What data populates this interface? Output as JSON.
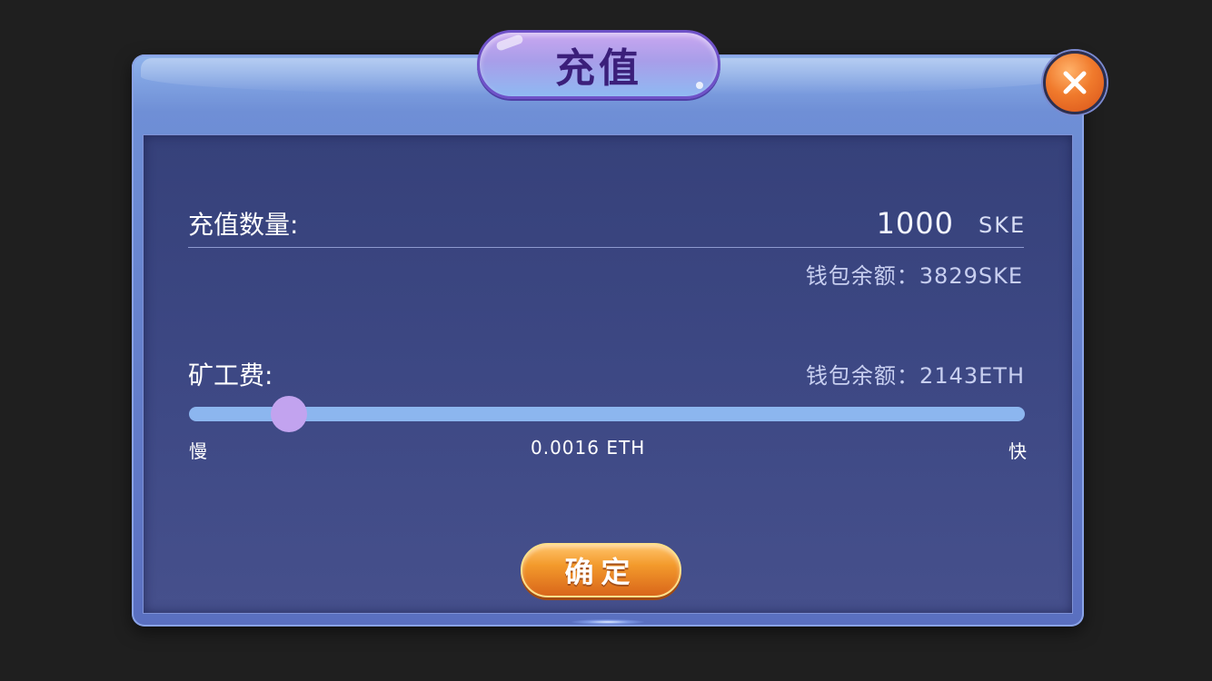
{
  "dialog": {
    "title": "充值",
    "close_icon": "close-icon"
  },
  "amount": {
    "label": "充值数量:",
    "value": "1000",
    "unit": "SKE",
    "balance": "钱包余额：3829SKE"
  },
  "fee": {
    "label": "矿工费:",
    "balance": "钱包余额：2143ETH",
    "slider_fraction": 0.12,
    "slow_label": "慢",
    "fast_label": "快",
    "value_label": "0.0016 ETH"
  },
  "confirm": {
    "label": "确定"
  },
  "colors": {
    "title_text": "#3b1f7a",
    "slider_track": "#8cb6ef",
    "slider_thumb": "#c2a3ef",
    "confirm_button": "#f39a2c",
    "close_button": "#f07a2c",
    "panel": "#3d4884"
  }
}
